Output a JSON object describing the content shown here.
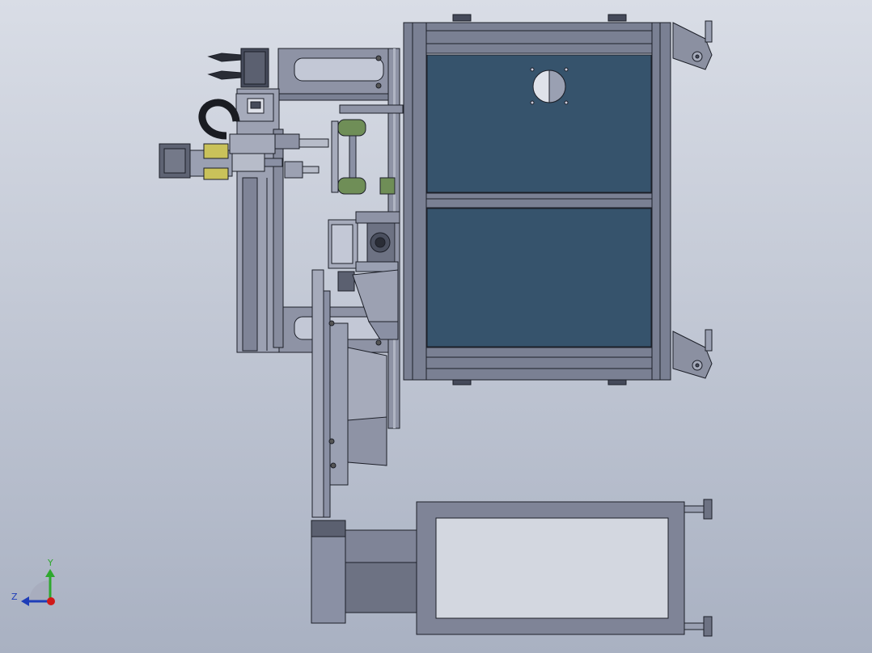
{
  "viewport": {
    "background_top": "#d9dde6",
    "background_bottom": "#a9b1c2"
  },
  "colors": {
    "frame": "#7a8093",
    "frame_light": "#a6abbb",
    "frame_dark": "#454a5a",
    "panel": "#36536c",
    "edge": "#1c1f28",
    "accent_green": "#6f8e57",
    "accent_yellow": "#c9c25a",
    "motor": "#606575",
    "duct": "#8a90a4",
    "axis_y": "#2ea82e",
    "axis_z": "#1e3db8",
    "axis_origin": "#d01818"
  },
  "triad": {
    "y_label": "Y",
    "z_label": "Z"
  }
}
